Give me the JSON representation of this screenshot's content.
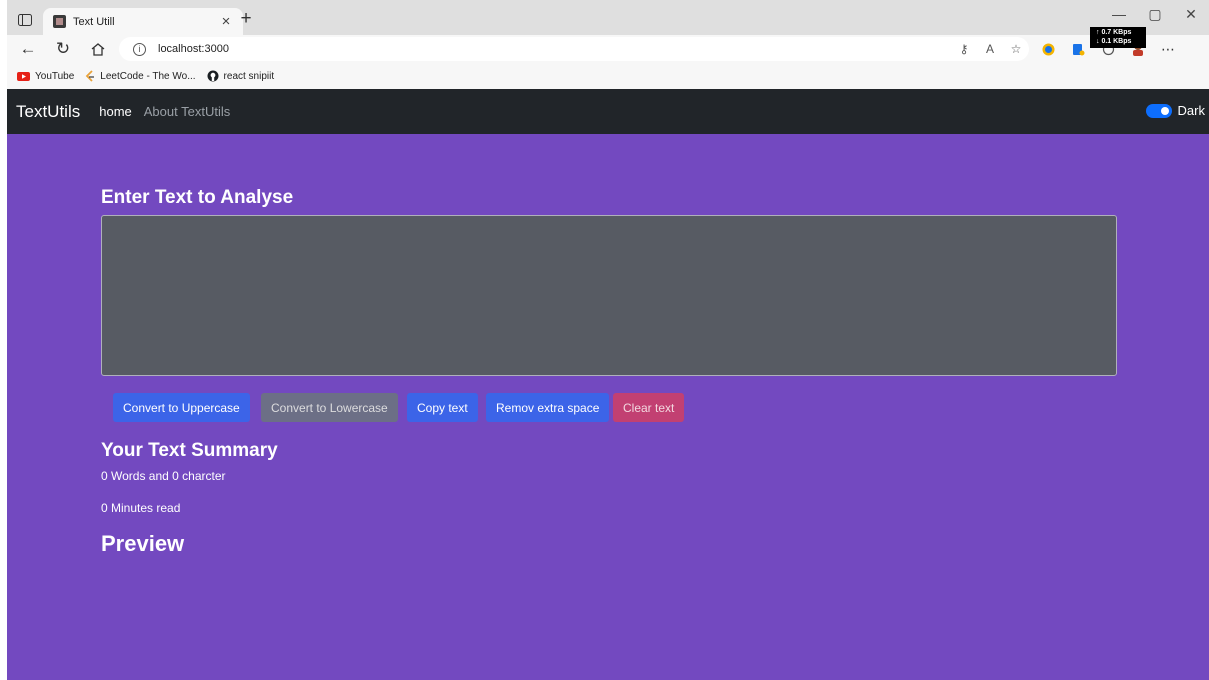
{
  "browser": {
    "tab_title": "Text Utill",
    "tab_close": "×",
    "new_tab": "+",
    "url": "localhost:3000",
    "network_up": "↑ 0.7 KBps",
    "network_down": "↓ 0.1 KBps",
    "window_controls": {
      "minimize": "—",
      "restore": "▢",
      "close": "✕"
    },
    "bookmarks": [
      {
        "label": "YouTube",
        "icon": "youtube-icon"
      },
      {
        "label": "LeetCode - The Wo...",
        "icon": "leetcode-icon"
      },
      {
        "label": "react snipiit",
        "icon": "github-icon"
      }
    ]
  },
  "navbar": {
    "brand": "TextUtils",
    "links": [
      {
        "label": "home",
        "active": true
      },
      {
        "label": "About TextUtils",
        "active": false
      }
    ],
    "toggle_label": "Dark",
    "toggle_on": true
  },
  "main": {
    "heading": "Enter Text to Analyse",
    "textarea_value": "",
    "buttons": [
      {
        "label": "Convert to Uppercase",
        "style": "primary"
      },
      {
        "label": "Convert to Lowercase",
        "style": "secondary"
      },
      {
        "label": "Copy text",
        "style": "primary"
      },
      {
        "label": "Remov extra space",
        "style": "primary"
      },
      {
        "label": "Clear text",
        "style": "danger"
      }
    ],
    "summary_title": "Your Text Summary",
    "word_count_line": "0 Words and 0 charcter",
    "read_time_line": "0 Minutes read",
    "preview_title": "Preview"
  },
  "colors": {
    "page_background": "#7349c0",
    "navbar_background": "#212529",
    "textarea_background": "#575b63",
    "primary_button": "#3c64e8",
    "secondary_button": "#6c6f86",
    "danger_button": "#c24072"
  }
}
